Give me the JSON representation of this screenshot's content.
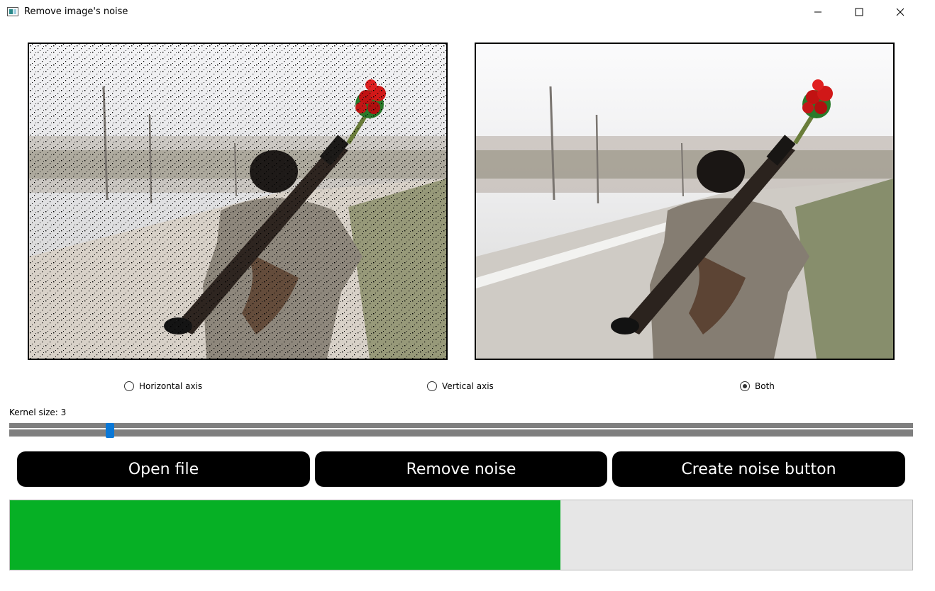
{
  "window": {
    "title": "Remove image's noise",
    "controls": [
      "minimize-icon",
      "maximize-icon",
      "close-icon"
    ]
  },
  "images": {
    "left_icon": "noisy-image-icon",
    "right_icon": "denoised-image-icon"
  },
  "radios": {
    "horizontal": {
      "label": "Horizontal axis",
      "checked": false
    },
    "vertical": {
      "label": "Vertical axis",
      "checked": false
    },
    "both": {
      "label": "Both",
      "checked": true
    }
  },
  "kernel": {
    "label": "Kernel size: 3",
    "value": 3,
    "slider_fraction": 0.108
  },
  "buttons": {
    "open": "Open file",
    "remove": "Remove noise",
    "create": "Create noise button"
  },
  "progress": {
    "percent": 61
  },
  "colors": {
    "progress_fill": "#06b025",
    "slider_handle": "#0a78d7",
    "button_bg": "#000000"
  }
}
